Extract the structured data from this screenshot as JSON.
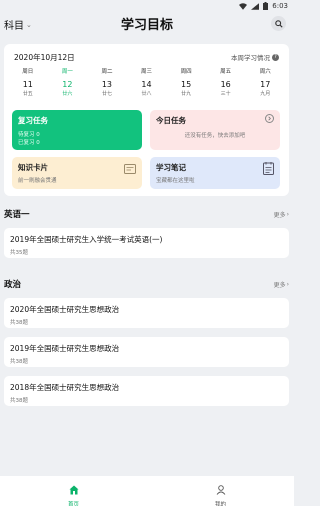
{
  "status_bar": {
    "time": "6:03"
  },
  "header": {
    "subject_label": "科目",
    "title": "学习目标"
  },
  "calendar": {
    "date": "2020年10月12日",
    "weekly_link": "本周学习情况",
    "days": [
      {
        "weekday": "周日",
        "day": "11",
        "lunar": "廿五"
      },
      {
        "weekday": "周一",
        "day": "12",
        "lunar": "廿六"
      },
      {
        "weekday": "周二",
        "day": "13",
        "lunar": "廿七"
      },
      {
        "weekday": "周三",
        "day": "14",
        "lunar": "廿八"
      },
      {
        "weekday": "周四",
        "day": "15",
        "lunar": "廿九"
      },
      {
        "weekday": "周五",
        "day": "16",
        "lunar": "三十"
      },
      {
        "weekday": "周六",
        "day": "17",
        "lunar": "九月"
      }
    ],
    "today_index": 1
  },
  "tiles": {
    "review": {
      "title": "复习任务",
      "pending": "待复习 0",
      "done": "已复习 0"
    },
    "today": {
      "title": "今日任务",
      "desc": "还没有任务，快去添加吧"
    },
    "cards": {
      "title": "知识卡片",
      "desc": "前一刷融会贯通"
    },
    "notes": {
      "title": "学习笔记",
      "desc": "宝藏都在这里啦"
    }
  },
  "sections": [
    {
      "title": "英语一",
      "more": "更多",
      "papers": [
        {
          "title": "2019年全国硕士研究生入学统一考试英语(一)",
          "count": "共35题"
        }
      ]
    },
    {
      "title": "政治",
      "more": "更多",
      "papers": [
        {
          "title": "2020年全国硕士研究生思想政治",
          "count": "共38题"
        },
        {
          "title": "2019年全国硕士研究生思想政治",
          "count": "共38题"
        },
        {
          "title": "2018年全国硕士研究生思想政治",
          "count": "共38题"
        }
      ]
    }
  ],
  "tabbar": {
    "home": "首页",
    "mine": "我的"
  },
  "colors": {
    "accent": "#0bb36a",
    "review_tile": "#12c27e",
    "today_tile": "#fde6e6",
    "cards_tile": "#fdeed2",
    "notes_tile": "#dfe8fa"
  }
}
